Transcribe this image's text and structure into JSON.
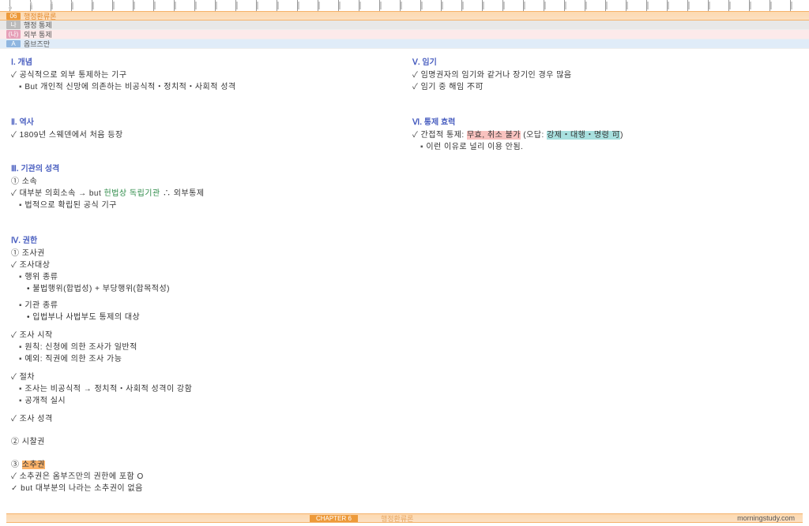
{
  "header": {
    "num": "06",
    "title": "행정환류론",
    "tag1_badge": "나",
    "tag1": "행정 통제",
    "tag2_badge": "(나)",
    "tag2": "외부 통제",
    "tag3_badge": "A",
    "tag3": "옴브즈만"
  },
  "left": {
    "s1_title": "Ⅰ. 개념",
    "s1_i1": "공식적으로 외부 통제하는 기구",
    "s1_i2p": "But 개인적 신망에 의존하는 ",
    "s1_i2g": "비공식적・정치적・사회적 성격",
    "s2_title": "Ⅱ. 역사",
    "s2_i1": "1809년 스웨덴에서 처음 등장",
    "s3_title": "Ⅲ. 기관의 성격",
    "s3_n1": "① 소속",
    "s3_i1a": "대부분 의회소속 → but ",
    "s3_i1b": "헌법상 독립기관",
    "s3_i1c": "   ∴ 외부통제",
    "s3_i2": "법적으로 확립된 공식 기구",
    "s4_title": "Ⅳ. 권한",
    "s4_n1": "① 조사권",
    "s4_c1": "조사대상",
    "s4_c1_b1": "행위 종류",
    "s4_c1_b1_d1": "불법행위(합법성) + 부당행위(합목적성)",
    "s4_c1_b2": "기관 종류",
    "s4_c1_b2_d1": "입법부나 사법부도 통제의 대상",
    "s4_c2": "조사 시작",
    "s4_c2_b1": "원칙: 신청에 의한 조사가 일반적",
    "s4_c2_b2": "예외: 직권에 의한 조사 가능",
    "s4_c3": "절차",
    "s4_c3_b1": "조사는 비공식적 → 정치적・사회적 성격이 강함",
    "s4_c3_b2": "공개적 실시",
    "s4_c4": "조사 성격",
    "s4_n2": "② 시찰권",
    "s4_n3": "③ ",
    "s4_n3_hl": "소추권",
    "s4_n3_i1": "소추권은 옴부즈만의 권한에 포함 O",
    "s4_n3_i2": "but 대부분의 나라는 소추권이 없음"
  },
  "right": {
    "s5_title": "Ⅴ. 임기",
    "s5_i1": "임명권자의 임기와 같거나 장기인 경우 많음",
    "s5_i2": "임기 중 해임 不可",
    "s6_title": "Ⅵ. 통제 효력",
    "s6_i1a": "간접적 통제: ",
    "s6_i1b": "무효, 취소 불가",
    "s6_i1c": " (오답: ",
    "s6_i1d": "강제・대행・명령  可",
    "s6_i1e": ")",
    "s6_i2": "이런 이유로 널리 이용 안됨."
  },
  "footer": {
    "chapter": "CHAPTER  6",
    "subject": "행정환류론",
    "site": "morningstudy.com"
  }
}
